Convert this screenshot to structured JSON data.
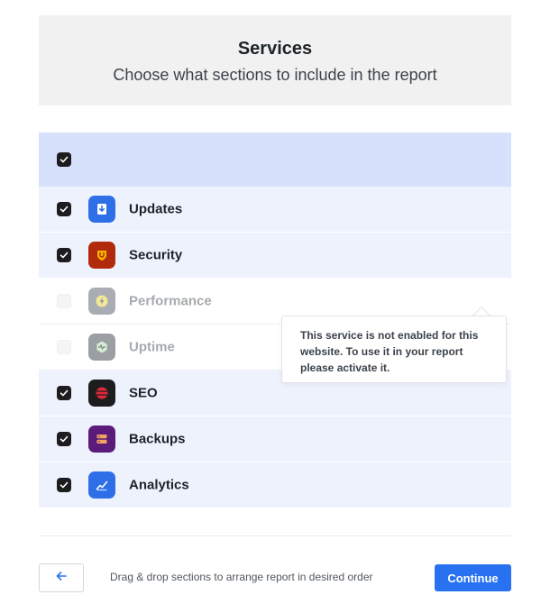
{
  "header": {
    "title": "Services",
    "subtitle": "Choose what sections to include in the report"
  },
  "select_all": {
    "checked": true
  },
  "services": [
    {
      "label": "Updates",
      "checked": true,
      "enabled": true,
      "icon": "updates-icon",
      "color": "#2e6fe8"
    },
    {
      "label": "Security",
      "checked": true,
      "enabled": true,
      "icon": "security-icon",
      "color": "#b02a0b"
    },
    {
      "label": "Performance",
      "checked": false,
      "enabled": false,
      "icon": "performance-icon",
      "color": "#a9adb3"
    },
    {
      "label": "Uptime",
      "checked": false,
      "enabled": false,
      "icon": "uptime-icon",
      "color": "#9b9fa4"
    },
    {
      "label": "SEO",
      "checked": true,
      "enabled": true,
      "icon": "seo-icon",
      "color": "#1d1d1f"
    },
    {
      "label": "Backups",
      "checked": true,
      "enabled": true,
      "icon": "backups-icon",
      "color": "#5b1b7a"
    },
    {
      "label": "Analytics",
      "checked": true,
      "enabled": true,
      "icon": "analytics-icon",
      "color": "#2e6fe8"
    }
  ],
  "tooltip": {
    "text": "This service is not enabled for this website. To use it in your report please activate it."
  },
  "footer": {
    "back_icon": "arrow-left-icon",
    "hint": "Drag & drop sections to arrange report in desired order",
    "continue_label": "Continue"
  },
  "colors": {
    "accent": "#2871f0",
    "row_bg": "#eef2fd",
    "head_bg": "#d6e2fb"
  }
}
